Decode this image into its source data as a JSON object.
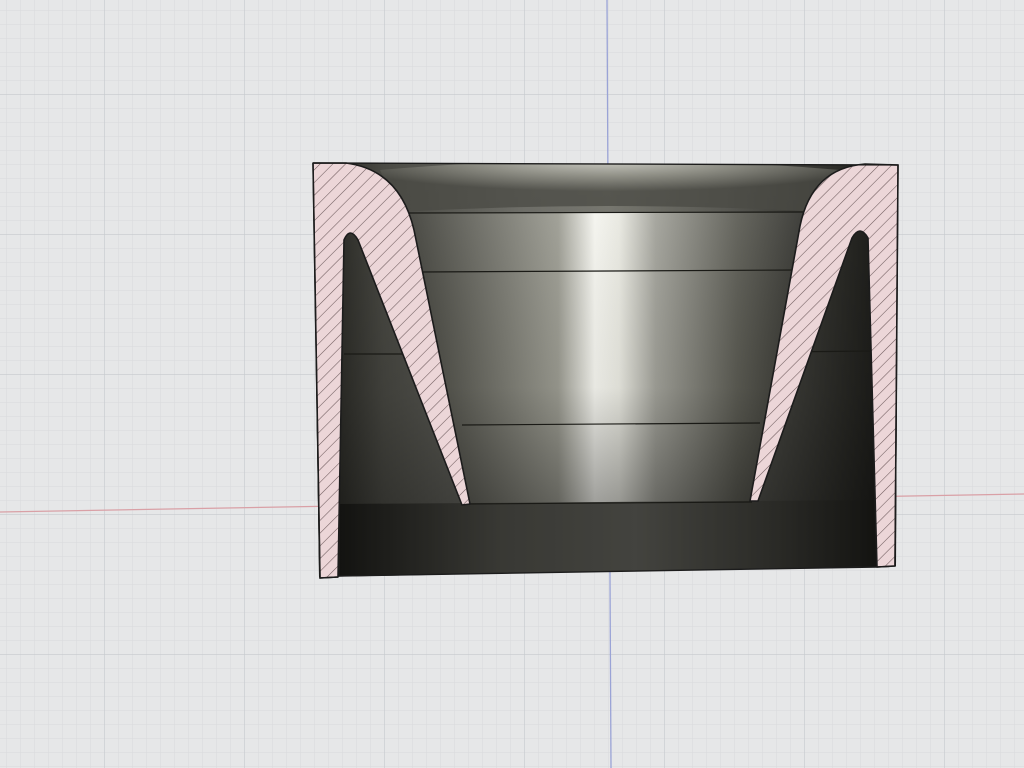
{
  "app": {
    "view": "cad-viewport",
    "mode": "section-analysis"
  },
  "grid": {
    "visible": true,
    "background_color": "#e4e5e6",
    "minor_line_color": "#d3d5d8",
    "major_line_color": "#bfc2c6",
    "x_axis_color": "#d9a0a6",
    "y_axis_color": "#9aa3d6"
  },
  "model": {
    "section_fill_color": "#ecd6d8",
    "hatch_color": "#6e5a5c",
    "outline_color": "#1c1c1c",
    "surface_dark_color": "#2a2a26",
    "surface_light_color": "#f0f0ea"
  }
}
